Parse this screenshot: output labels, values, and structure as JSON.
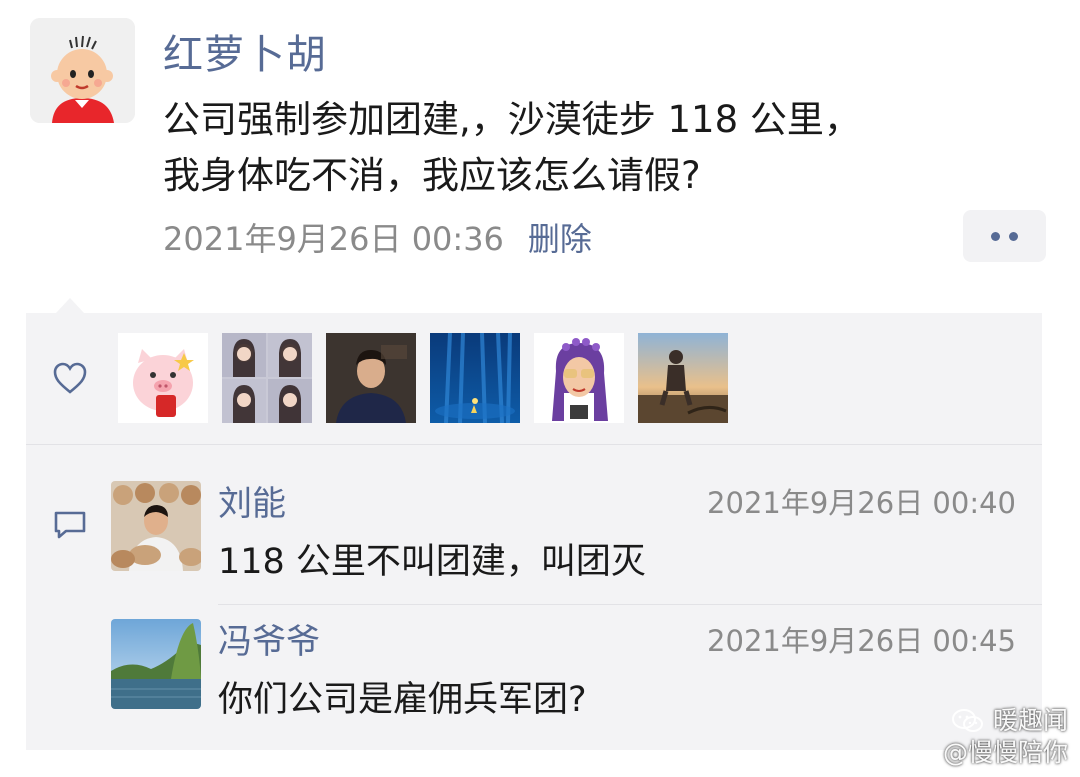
{
  "post": {
    "author": "红萝卜胡",
    "text_line1": "公司强制参加团建,，沙漠徒步 118 公里，",
    "text_line2": "我身体吃不消，我应该怎么请假?",
    "timestamp": "2021年9月26日 00:36",
    "delete_label": "删除"
  },
  "likes": {
    "icon": "heart-icon",
    "avatars": [
      "pig-avatar",
      "girls-grid-avatar",
      "man-portrait-avatar",
      "blue-forest-avatar",
      "cartoon-woman-avatar",
      "sunset-person-avatar"
    ]
  },
  "comments": [
    {
      "name": "刘能",
      "time": "2021年9月26日 00:40",
      "text": "118 公里不叫团建，叫团灭"
    },
    {
      "name": "冯爷爷",
      "time": "2021年9月26日 00:45",
      "text": "你们公司是雇佣兵军团?"
    }
  ],
  "watermark": {
    "line1": "暖趣闻",
    "line2": "@慢慢陪你"
  },
  "colors": {
    "link": "#576b95",
    "panel": "#f3f3f5",
    "text": "#1a1a1a",
    "meta": "#8a8a8a"
  }
}
